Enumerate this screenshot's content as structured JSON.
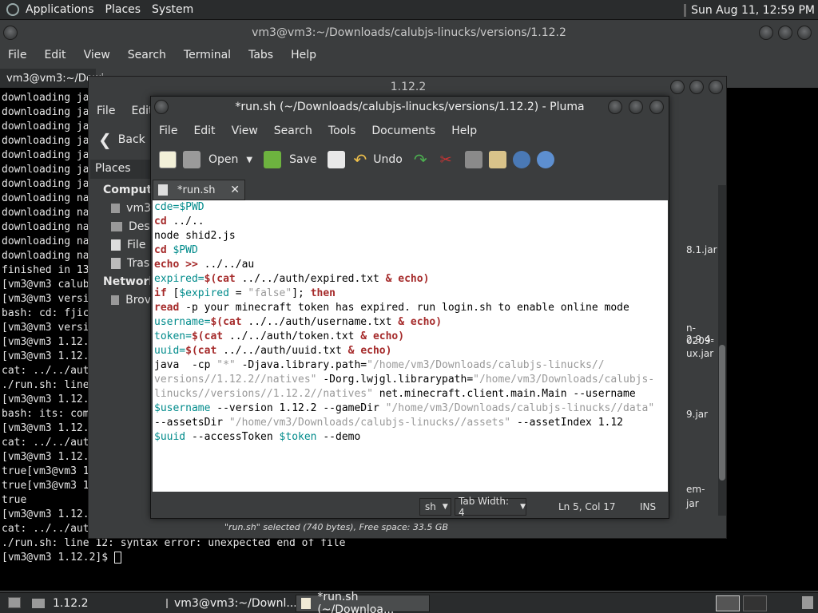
{
  "topbar": {
    "menus": [
      "Applications",
      "Places",
      "System"
    ],
    "clock": "Sun Aug 11, 12:59 PM"
  },
  "terminal": {
    "title": "vm3@vm3:~/Downloads/calubjs-linucks/versions/1.12.2",
    "menu": [
      "File",
      "Edit",
      "View",
      "Search",
      "Terminal",
      "Tabs",
      "Help"
    ],
    "tab_label": "vm3@vm3:~/Dowi",
    "lines": [
      "downloading ja",
      "downloading ja",
      "downloading ja",
      "downloading ja",
      "downloading ja",
      "downloading ja",
      "downloading ja",
      "downloading na",
      "downloading na",
      "downloading na",
      "downloading na",
      "downloading na",
      "",
      "finished in 13",
      "[vm3@vm3 calub",
      "[vm3@vm3 versi",
      "bash: cd: fjic",
      "[vm3@vm3 versi",
      "[vm3@vm3 1.12.",
      "[vm3@vm3 1.12.",
      "cat: ../../aut",
      "./run.sh: line",
      "[vm3@vm3 1.12.",
      "bash: its: com",
      "[vm3@vm3 1.12.",
      "cat: ../../aut",
      "[vm3@vm3 1.12.",
      "true[vm3@vm3 1",
      "true[vm3@vm3 1",
      "true",
      "[vm3@vm3 1.12.",
      "cat: ../../auth/expired.txt: No such file or directory",
      "./run.sh: line 12: syntax error: unexpected end of file",
      "[vm3@vm3 1.12.2]$ "
    ]
  },
  "filemanager": {
    "title": "1.12.2",
    "menu": [
      "File",
      "Edit"
    ],
    "back_label": "Back",
    "places_label": "Places",
    "sections": {
      "computer": "Compute",
      "network": "Network"
    },
    "items": [
      "vm3",
      "Des",
      "File",
      "Tras"
    ],
    "network_items": [
      "Brov"
    ],
    "right_files": [
      "8.1.jar",
      "n-2.9.4-",
      "0209-",
      "ux.jar",
      "9.jar",
      "em-",
      "jar"
    ],
    "status": "\"run.sh\" selected (740 bytes), Free space: 33.5 GB"
  },
  "pluma": {
    "title": "*run.sh (~/Downloads/calubjs-linucks/versions/1.12.2) - Pluma",
    "menu": [
      "File",
      "Edit",
      "View",
      "Search",
      "Tools",
      "Documents",
      "Help"
    ],
    "toolbar": {
      "open": "Open",
      "save": "Save",
      "undo": "Undo"
    },
    "tab_label": "*run.sh",
    "status": {
      "lang": "sh",
      "tabwidth": "Tab Width:  4",
      "pos": "Ln 5, Col 17",
      "mode": "INS"
    }
  },
  "code": [
    [
      {
        "t": "cde=",
        "c": "var"
      },
      {
        "t": "$PWD",
        "c": "var"
      }
    ],
    [
      {
        "t": "cd",
        "c": "kw"
      },
      {
        "t": " ../..",
        "c": ""
      }
    ],
    [
      {
        "t": "node shid2.js",
        "c": ""
      }
    ],
    [
      {
        "t": "cd",
        "c": "kw"
      },
      {
        "t": " ",
        "c": ""
      },
      {
        "t": "$PWD",
        "c": "var"
      }
    ],
    [
      {
        "t": "echo",
        "c": "kw"
      },
      {
        "t": " ",
        "c": ""
      },
      {
        "t": ">>",
        "c": "kw"
      },
      {
        "t": " ../../au",
        "c": ""
      }
    ],
    [
      {
        "t": "expired=",
        "c": "var"
      },
      {
        "t": "$(cat",
        "c": "kw"
      },
      {
        "t": " ../../auth/expired.txt ",
        "c": ""
      },
      {
        "t": "&",
        "c": "kw"
      },
      {
        "t": " ",
        "c": ""
      },
      {
        "t": "echo)",
        "c": "kw"
      }
    ],
    [
      {
        "t": "if",
        "c": "kw"
      },
      {
        "t": " [",
        "c": ""
      },
      {
        "t": "$expired",
        "c": "var"
      },
      {
        "t": " = ",
        "c": ""
      },
      {
        "t": "\"false\"",
        "c": "str"
      },
      {
        "t": "];",
        "c": ""
      },
      {
        "t": " then",
        "c": "kw"
      }
    ],
    [
      {
        "t": "read",
        "c": "kw"
      },
      {
        "t": " -p your minecraft token has expired. run login.sh to enable online mode",
        "c": ""
      }
    ],
    [
      {
        "t": "username=",
        "c": "var"
      },
      {
        "t": "$(cat",
        "c": "kw"
      },
      {
        "t": " ../../auth/username.txt ",
        "c": ""
      },
      {
        "t": "&",
        "c": "kw"
      },
      {
        "t": " ",
        "c": ""
      },
      {
        "t": "echo)",
        "c": "kw"
      }
    ],
    [
      {
        "t": "token=",
        "c": "var"
      },
      {
        "t": "$(cat",
        "c": "kw"
      },
      {
        "t": " ../../auth/token.txt ",
        "c": ""
      },
      {
        "t": "&",
        "c": "kw"
      },
      {
        "t": " ",
        "c": ""
      },
      {
        "t": "echo)",
        "c": "kw"
      }
    ],
    [
      {
        "t": "uuid=",
        "c": "var"
      },
      {
        "t": "$(cat",
        "c": "kw"
      },
      {
        "t": " ../../auth/uuid.txt ",
        "c": ""
      },
      {
        "t": "&",
        "c": "kw"
      },
      {
        "t": " ",
        "c": ""
      },
      {
        "t": "echo)",
        "c": "kw"
      }
    ],
    [
      {
        "t": "java  -cp ",
        "c": ""
      },
      {
        "t": "\"*\"",
        "c": "str"
      },
      {
        "t": " -Djava.library.path=",
        "c": ""
      },
      {
        "t": "\"/home/vm3/Downloads/calubjs-linucks//",
        "c": "str"
      }
    ],
    [
      {
        "t": "versions//1.12.2//natives\"",
        "c": "str"
      },
      {
        "t": " -Dorg.lwjgl.librarypath=",
        "c": ""
      },
      {
        "t": "\"/home/vm3/Downloads/calubjs-",
        "c": "str"
      }
    ],
    [
      {
        "t": "linucks//versions//1.12.2//natives\"",
        "c": "str"
      },
      {
        "t": " net.minecraft.client.main.Main --username",
        "c": ""
      }
    ],
    [
      {
        "t": "$username",
        "c": "var"
      },
      {
        "t": " --version 1.12.2 --gameDir ",
        "c": ""
      },
      {
        "t": "\"/home/vm3/Downloads/calubjs-linucks//data\"",
        "c": "str"
      }
    ],
    [
      {
        "t": "--assetsDir ",
        "c": ""
      },
      {
        "t": "\"/home/vm3/Downloads/calubjs-linucks//assets\"",
        "c": "str"
      },
      {
        "t": " --assetIndex 1.12",
        "c": ""
      }
    ],
    [
      {
        "t": "$uuid",
        "c": "var"
      },
      {
        "t": " --accessToken ",
        "c": ""
      },
      {
        "t": "$token",
        "c": "var"
      },
      {
        "t": " --demo",
        "c": ""
      }
    ]
  ],
  "taskbar": [
    {
      "label": "1.12.2"
    },
    {
      "label": "vm3@vm3:~/Downl..."
    },
    {
      "label": "*run.sh (~/Downloa..."
    }
  ]
}
